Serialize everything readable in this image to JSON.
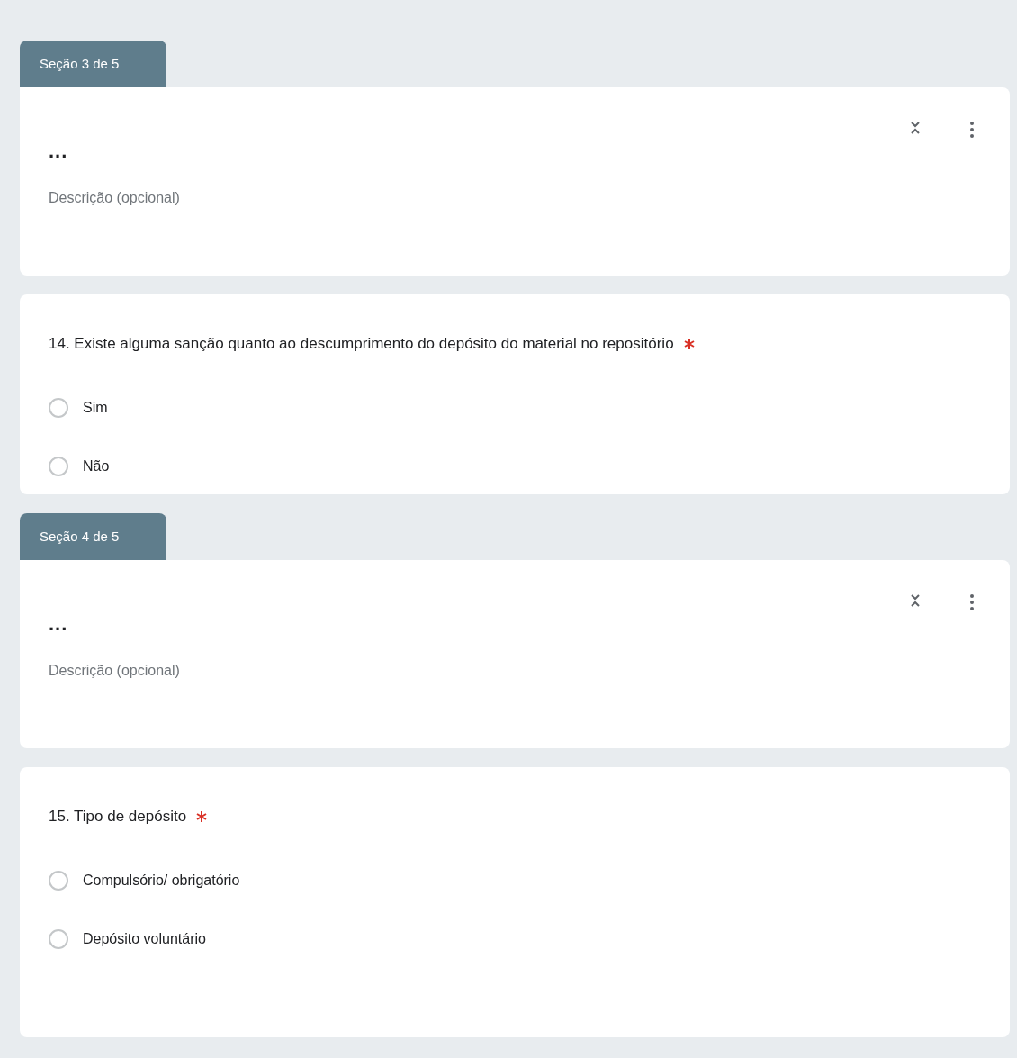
{
  "sections": [
    {
      "tab": "Seção 3 de 5",
      "title": "...",
      "description": {
        "placeholder": "Descrição (opcional)"
      },
      "question": {
        "text": "14. Existe alguma sanção quanto ao descumprimento do depósito do material no repositório",
        "required": true,
        "options": [
          {
            "label": "Sim",
            "selected": false
          },
          {
            "label": "Não",
            "selected": false
          }
        ]
      }
    },
    {
      "tab": "Seção 4 de 5",
      "title": "...",
      "description": {
        "placeholder": "Descrição (opcional)"
      },
      "question": {
        "text": "15. Tipo de depósito",
        "required": true,
        "options": [
          {
            "label": "Compulsório/ obrigatório",
            "selected": false
          },
          {
            "label": "Depósito voluntário",
            "selected": false
          }
        ]
      }
    }
  ]
}
